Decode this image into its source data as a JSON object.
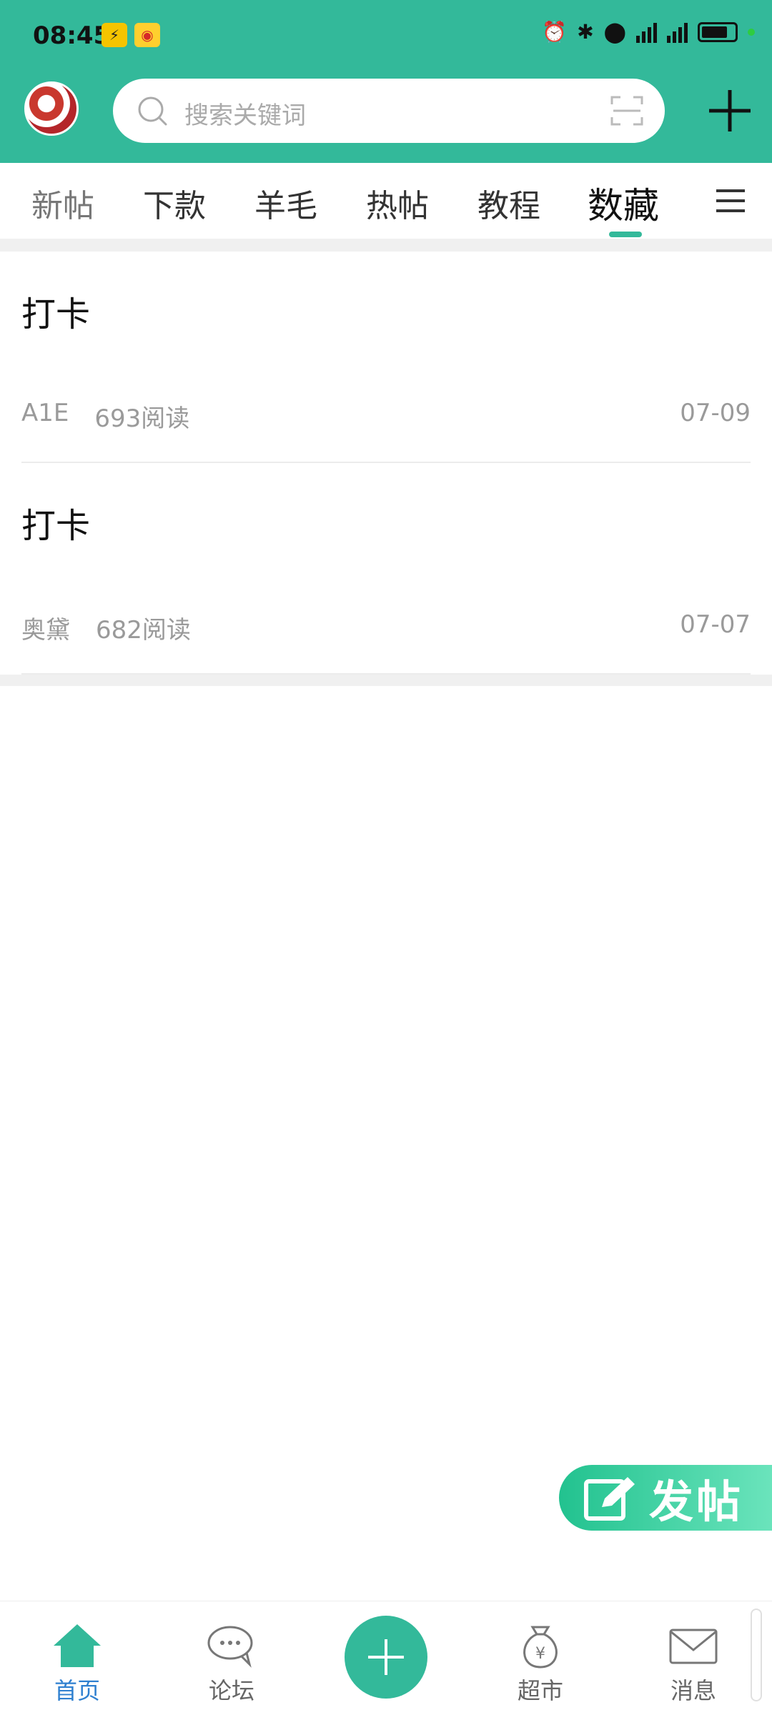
{
  "status": {
    "time": "08:45",
    "notif_a": "",
    "notif_b": ""
  },
  "search": {
    "placeholder": "搜索关键词"
  },
  "tabs": [
    {
      "label": "新帖"
    },
    {
      "label": "下款"
    },
    {
      "label": "羊毛"
    },
    {
      "label": "热帖"
    },
    {
      "label": "教程"
    },
    {
      "label": "数藏"
    }
  ],
  "posts": [
    {
      "title": "打卡",
      "author": "A1E",
      "reads": "693阅读",
      "date": "07-09"
    },
    {
      "title": "打卡",
      "author": "奥黛",
      "reads": "682阅读",
      "date": "07-07"
    }
  ],
  "fab": {
    "label": "发帖"
  },
  "nav": {
    "home": "首页",
    "forum": "论坛",
    "market": "超市",
    "messages": "消息"
  },
  "colors": {
    "accent": "#33b99a",
    "active_nav": "#2f80d0",
    "meta_text": "#9a9a9a"
  }
}
